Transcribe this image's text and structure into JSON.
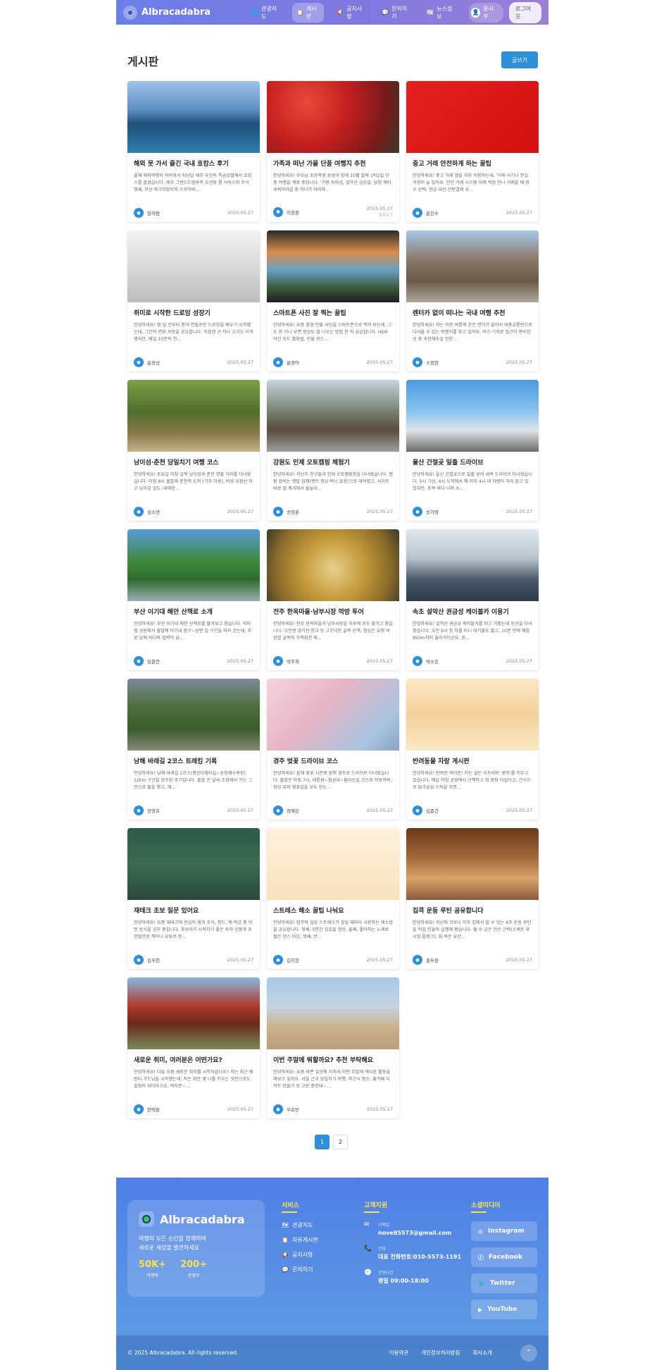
{
  "header": {
    "logo": "Albracadabra",
    "nav": [
      {
        "icon": "globe-icon",
        "glyph": "🌐",
        "label": "관광지도"
      },
      {
        "icon": "clipboard-icon",
        "glyph": "📋",
        "label": "게시판"
      },
      {
        "icon": "megaphone-icon",
        "glyph": "📢",
        "label": "공지사항"
      },
      {
        "icon": "chat-icon",
        "glyph": "💬",
        "label": "문의하기"
      },
      {
        "icon": "newspaper-icon",
        "glyph": "📰",
        "label": "뉴스정보"
      }
    ],
    "user": "윤시우",
    "logout": "로그아웃"
  },
  "board": {
    "title": "게시판",
    "write_button": "글쓰기"
  },
  "posts": [
    {
      "title": "해외 못 가서 즐긴 국내 호캉스 후기",
      "excerpt": "올해 해외여행이 어려워서 지난달 제주·부산의 특급호텔에서 호캉스를 즐겼습니다. 제주 그랜드드림바의 오션뷰 룸 서비스와 조식 뷔페, 부산 파크하얏트의 스카이바...",
      "author": "임하람",
      "date": "2025.05.27",
      "views": ""
    },
    {
      "title": "가족과 떠난 가을 단풍 여행지 추천",
      "excerpt": "안녕하세요! 부모님 초등학생 동생과 함께 10월 말에 1박2일 단풍 여행을 계획 중입니다. '가평 자라섬, 설악산 금강굴, 담양 메타세쿼이아길 중 어디가 아이와...",
      "author": "이정훈",
      "date": "2025.05.27",
      "views": "조회수 7"
    },
    {
      "title": "중고 거래 안전하게 하는 꿀팁",
      "excerpt": "안녕하세요! 중고 거래 앱을 자주 이용하는데, '거래 사기나 분실 걱정이 늘 있어요. 안전 거래 시스템 이에 직접 만나 거래할 때 장소 선택, 현금 대신 간편결제 사...",
      "author": "윤진수",
      "date": "2025.05.27",
      "views": ""
    },
    {
      "title": "취미로 시작한 드로잉 성장기",
      "excerpt": "안녕하세요! 몇 달 전부터 종이·연필로만 드로잉을 배우기 시작했는데, 그간의 변화 과정을 공유합니다. 처음엔 선 하나 긋기도 어색했지만, 매일 10분씩 연...",
      "author": "윤경상",
      "date": "2025.05.27",
      "views": ""
    },
    {
      "title": "스마트폰 사진 잘 찍는 꿀팁",
      "excerpt": "안녕하세요! 요즘 풍경·인물 사진을 스마트폰으로 찍어 보는데, 그도 한 거나 보면 항상도 잘 나오는 방법 한 이 궁금합니다. HDR·야간 모드 활용법, 인물 모드...",
      "author": "윤경아",
      "date": "2025.05.27",
      "views": ""
    },
    {
      "title": "렌터카 없이 떠나는 국내 여행 추천",
      "excerpt": "안녕하세요! 저는 이번 여름에 운전 면허가 없어서 대중교통만으로 다녀올 수 있는 여행지를 찾고 있어요. 버스·기차로 접근이 편리한 곳 중 추천해주실 만한...",
      "author": "소정현",
      "date": "2025.05.27",
      "views": ""
    },
    {
      "title": "남이섬·춘천 당일치기 여행 코스",
      "excerpt": "안녕하세요! 토요일 아침 일찍 남이섬과 춘천 명물 거리를 다녀왔습니다. 아침 8시 출발해 춘천역 도착 (기차 이용), 바로 유람선 타고 남이섬 입도. 대여한...",
      "author": "심소연",
      "date": "2025.05.27",
      "views": ""
    },
    {
      "title": "강원도 인제 오토캠핑 체험기",
      "excerpt": "안녕하세요! 지난주 친구들과 인제 오토캠핑장을 다녀왔습니다. 캠핑 장비는 렌탈 업체(렌트·침낭·버너 포함)으로 대여했고, 사이트 바로 옆 계곡에서 물놀이...",
      "author": "송영훈",
      "date": "2025.05.27",
      "views": ""
    },
    {
      "title": "울산 간절곶 일출 드라이브",
      "excerpt": "안녕하세요! 울산 간절곶으로 일출 보러 새벽 드라이브 다녀왔습니다. 5시 기상, 4시 도착해서 해 이미 4시 대 차량이 자리 잡고 있었지만, 동쪽 바다 너머 수...",
      "author": "송가영",
      "date": "2025.05.27",
      "views": ""
    },
    {
      "title": "부산 이기대 해안 산책로 소개",
      "excerpt": "안녕하세요! 부산 이기대 해안 산책로를 즐겨보고 왔습니다. 이미 첨 공원에서 출발해 이기대 암구~강변 길 구간을 따라 걷는데, 푸른 남해 바다와 절벽이 굽...",
      "author": "임준안",
      "date": "2025.05.27",
      "views": ""
    },
    {
      "title": "전주 한옥마을·남부시장 먹방 투어",
      "excerpt": "안녕하세요! 전주 한옥마을과 남부시장을 하루에 모두 즐기고 왔습니다. 오전엔 경기전·향교 등 고즈넉한 골목 산책, 점심은 유명 비빔밥 골목의 가족회관 에...",
      "author": "박주혁",
      "date": "2025.05.27",
      "views": ""
    },
    {
      "title": "속초 설악산 권금성 케이블카 이용기",
      "excerpt": "안녕하세요! 설악산 권금성 케이블카를 타고 가봤는데 등산을 다녀왔습니다. 오전 9시 첫 차를 타니 대기줄도 짧고, 10분 만에 해발 850m까지 올라가더군요. 권...",
      "author": "박소진",
      "date": "2025.05.27",
      "views": ""
    },
    {
      "title": "남해 바래길 2코스 트레킹 기록",
      "excerpt": "안녕하세요! 남해 바래길 2코스(앵강다랭이길~송정해수욕장) 12km 구간을 완주한 후기입니다. 출발 전 날씨 조회해서 가는 그 전으로 물을 챙고, 해...",
      "author": "장영호",
      "date": "2025.05.27",
      "views": ""
    },
    {
      "title": "경주 벚꽃 드라이브 코스",
      "excerpt": "안녕하세요! 올해 벚꽃 시즌에 맞춰 경주로 드라이브 다녀왔습니다. 출발은 아침 7시, 대릉원~첨성대~황리단길 코스로 이동하며, 정상 뷰와 벚꽃길을 모두 한눈...",
      "author": "정예린",
      "date": "2025.05.27",
      "views": ""
    },
    {
      "title": "반려동물 자랑 게시판",
      "excerpt": "안녕하세요! 반려견 여러분! 저는 골든 리트리버 '콩이'를 키우고 있습니다. 매일 아침 공원에서 산책하고 최 화탕 타일어고, 간식으로 닭가슴살 스틱을 주면...",
      "author": "김준건",
      "date": "2025.05.27",
      "views": ""
    },
    {
      "title": "재테크 초보 질문 있어요",
      "excerpt": "안녕하세요! 요즘 재테크에 관심이 생겨 주식, 펀드, 예·적금 중 어떤 방식을 공부 중입니다. 초보자가 시작하기 좋은 투자 상품과 추천할만한 책이나 유튜브 등...",
      "author": "김우현",
      "date": "2025.05.27",
      "views": ""
    },
    {
      "title": "스트레스 해소 꿀팁 나눠요",
      "excerpt": "안녕하세요! 업무와 일상 스트레스가 쌓일 때마다 사용하는 해소법을 공유합니다. 첫째, 5분간 심호흡 명상, 둘째, 좋아하는 노래로 짧은 댄스 타임, 셋째, 반...",
      "author": "김지현",
      "date": "2025.05.27",
      "views": ""
    },
    {
      "title": "집콕 운동 루틴 공유합니다",
      "excerpt": "안녕하세요! 지난해 코로나 이후 집에서 할 수 있는 4주 운동 루틴을 직접 만들어 실행해 봤습니다. 월·수·금은 전신 근력(스쿼트·푸시업·플랭크), 화·목은 유산...",
      "author": "홍두원",
      "date": "2025.05.27",
      "views": ""
    },
    {
      "title": "새로운 취미, 여러분은 어떤가요?",
      "excerpt": "안녕하세요! 다들 요즘 새로운 취미를 시작하셨나요? 저는 최근 베란다 가드닝을 시작했는데, 작은 화분 몇 나를 키우는 것만으로도 힐링이 되더라고요. 여러분~...",
      "author": "전택훈",
      "date": "2025.05.27",
      "views": ""
    },
    {
      "title": "이번 주말에 뭐할까요? 추천 부탁해요",
      "excerpt": "안녕하세요! 요즘 바쁜 일상에 지쳐서 이번 주말에 색다른 활동을 해보고 싶어요. 서울 근교 당일치기 여행, 피크닉 명소, 홈카페 디저트 만들기 등 고민 중인데~...",
      "author": "우효빈",
      "date": "2025.05.27",
      "views": ""
    }
  ],
  "pagination": {
    "pages": [
      "1",
      "2"
    ],
    "current": "1"
  },
  "footer": {
    "brand": "Albracadabra",
    "tagline_1": "여행의 모든 순간을 함께하며",
    "tagline_2": "새로운 세상을 발견하세요",
    "stats": [
      {
        "value": "50K+",
        "label": "여행객"
      },
      {
        "value": "200+",
        "label": "관광지"
      }
    ],
    "services_title": "서비스",
    "services": [
      {
        "icon": "map-icon",
        "glyph": "🗺",
        "label": "관광지도"
      },
      {
        "icon": "clipboard-icon",
        "glyph": "📋",
        "label": "자유게시판"
      },
      {
        "icon": "megaphone-icon",
        "glyph": "📢",
        "label": "공지사항"
      },
      {
        "icon": "chat-icon",
        "glyph": "💬",
        "label": "문의하기"
      }
    ],
    "contact_title": "고객지원",
    "contacts": [
      {
        "icon": "mail-icon",
        "glyph": "✉",
        "label": "이메일",
        "value": "nove85573@gmail.com"
      },
      {
        "icon": "phone-icon",
        "glyph": "📞",
        "label": "전화",
        "value": "대표 전화번호:010-5573-1191"
      },
      {
        "icon": "clock-icon",
        "glyph": "🕘",
        "label": "운영시간",
        "value": "평일 09:00-18:00"
      }
    ],
    "social_title": "소셜미디어",
    "social": [
      {
        "icon": "instagram-icon",
        "glyph": "◎",
        "label": "Instagram"
      },
      {
        "icon": "facebook-icon",
        "glyph": "ⓕ",
        "label": "Facebook"
      },
      {
        "icon": "twitter-icon",
        "glyph": "🐦",
        "label": "Twitter"
      },
      {
        "icon": "youtube-icon",
        "glyph": "▶",
        "label": "YouTube"
      }
    ],
    "copyright": "© 2025 Albracadabra. All rights reserved.",
    "bottom_links": [
      "이용약관",
      "개인정보처리방침",
      "회사소개"
    ],
    "top_button": "⌃"
  }
}
